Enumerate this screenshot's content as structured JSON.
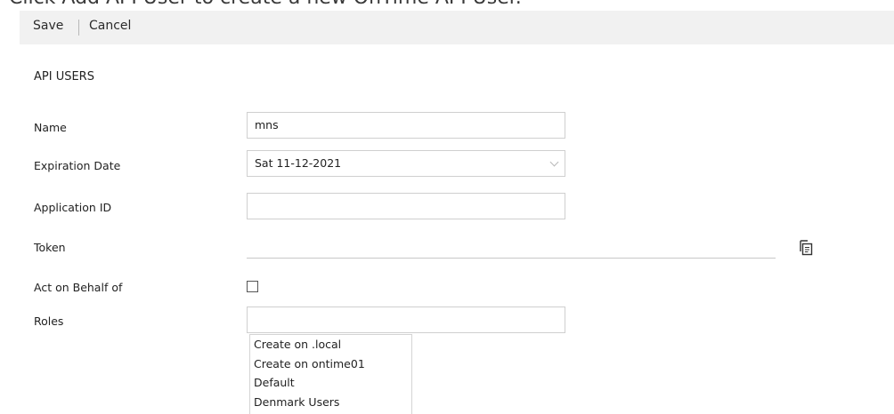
{
  "banner": {
    "text": "Click Add API User to create a new OnTime API User."
  },
  "toolbar": {
    "save_label": "Save",
    "cancel_label": "Cancel"
  },
  "section": {
    "title": "API USERS"
  },
  "form": {
    "name": {
      "label": "Name",
      "value": "mns"
    },
    "expiration_date": {
      "label": "Expiration Date",
      "value": "Sat 11-12-2021"
    },
    "application_id": {
      "label": "Application ID",
      "value": ""
    },
    "token": {
      "label": "Token",
      "value": ""
    },
    "act_on_behalf_of": {
      "label": "Act on Behalf of",
      "checked": false
    },
    "roles": {
      "label": "Roles",
      "value": "",
      "options": [
        "Create on .local",
        "Create on ontime01",
        "Default",
        "Denmark Users"
      ]
    }
  },
  "icons": {
    "token_copy": "copy-icon",
    "dropdown": "chevron-down-icon"
  }
}
